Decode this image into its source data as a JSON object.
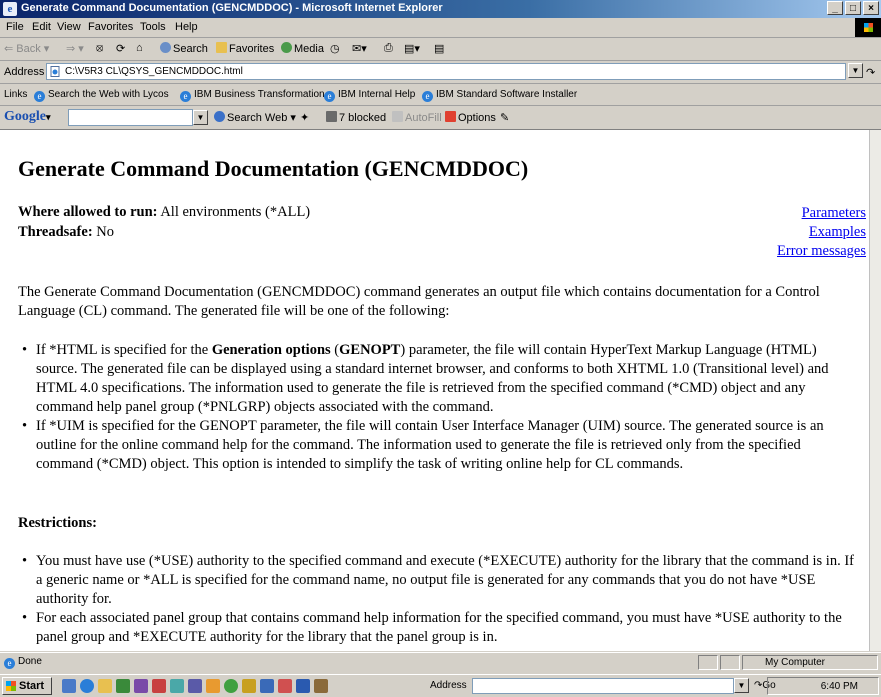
{
  "window": {
    "title": "Generate Command Documentation (GENCMDDOC) - Microsoft Internet Explorer"
  },
  "menu": [
    "File",
    "Edit",
    "View",
    "Favorites",
    "Tools",
    "Help"
  ],
  "toolbar": {
    "back": "Back",
    "search": "Search",
    "favorites": "Favorites",
    "media": "Media"
  },
  "address": {
    "label": "Address",
    "value": "C:\\V5R3 CL\\QSYS_GENCMDDOC.html",
    "go": "Go"
  },
  "links": {
    "label": "Links",
    "items": [
      "Search the Web with Lycos",
      "IBM Business Transformation",
      "IBM Internal Help",
      "IBM Standard Software Installer"
    ]
  },
  "google": {
    "logo": "Google",
    "search_web": "Search Web",
    "blocked": "7 blocked",
    "autofill": "AutoFill",
    "options": "Options"
  },
  "page": {
    "title": "Generate Command Documentation (GENCMDDOC)",
    "where_label": "Where allowed to run:",
    "where_value": "All environments (*ALL)",
    "threadsafe_label": "Threadsafe:",
    "threadsafe_value": "No",
    "side_links": [
      "Parameters",
      "Examples",
      "Error messages"
    ],
    "intro": "The Generate Command Documentation (GENCMDDOC) command generates an output file which contains documentation for a Control Language (CL) command. The generated file will be one of the following:",
    "bullet1_pre": "If *HTML is specified for the ",
    "bullet1_b1": "Generation options",
    "bullet1_mid": " (",
    "bullet1_b2": "GENOPT",
    "bullet1_post": ") parameter, the file will contain HyperText Markup Language (HTML) source. The generated file can be displayed using a standard internet browser, and conforms to both XHTML 1.0 (Transitional level) and HTML 4.0 specifications. The information used to generate the file is retrieved from the specified command (*CMD) object and any command help panel group (*PNLGRP) objects associated with the command.",
    "bullet2": "If *UIM is specified for the GENOPT parameter, the file will contain User Interface Manager (UIM) source. The generated source is an outline for the online command help for the command. The information used to generate the file is retrieved only from the specified command (*CMD) object. This option is intended to simplify the task of writing online help for CL commands.",
    "restrictions_heading": "Restrictions:",
    "restriction1": "You must have use (*USE) authority to the specified command and execute (*EXECUTE) authority for the library that the command is in. If a generic name or *ALL is specified for the command name, no output file is generated for any commands that you do not have *USE authority for.",
    "restriction2": "For each associated panel group that contains command help information for the specified command, you must have *USE authority to the panel group and *EXECUTE authority for the library that the panel group is in."
  },
  "status": {
    "text": "Done",
    "zone": "My Computer"
  },
  "taskbar": {
    "start": "Start",
    "address_label": "Address",
    "go": "Go",
    "clock": "6:40 PM"
  }
}
